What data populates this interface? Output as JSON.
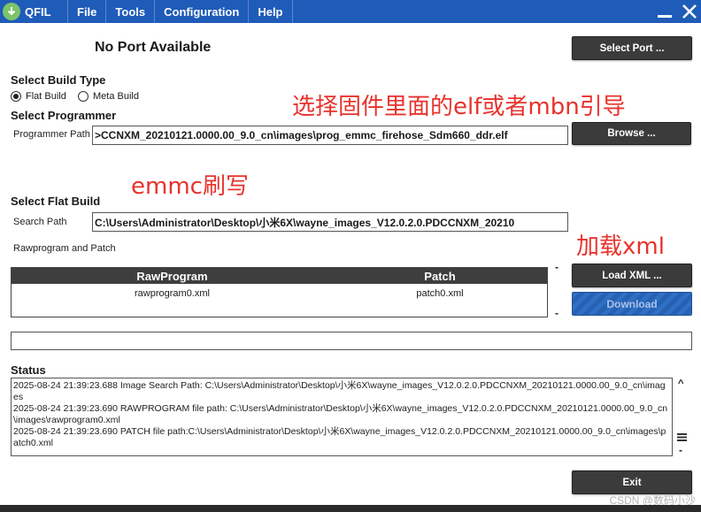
{
  "window": {
    "app_title": "QFIL",
    "menu": [
      "File",
      "Tools",
      "Configuration",
      "Help"
    ],
    "controls": [
      "minimize-icon",
      "close-icon"
    ]
  },
  "port": {
    "status_text": "No Port Available",
    "select_button": "Select Port ..."
  },
  "build_type": {
    "title": "Select Build Type",
    "options": [
      "Flat Build",
      "Meta Build"
    ],
    "selected": "Flat Build"
  },
  "programmer": {
    "title": "Select Programmer",
    "label": "Programmer Path",
    "path": ">CCNXM_20210121.0000.00_9.0_cn\\images\\prog_emmc_firehose_Sdm660_ddr.elf",
    "browse_button": "Browse ..."
  },
  "flat_build": {
    "title": "Select Flat Build",
    "search_label": "Search Path",
    "search_path": "C:\\Users\\Administrator\\Desktop\\小米6X\\wayne_images_V12.0.2.0.PDCCNXM_20210",
    "raw_patch_label": "Rawprogram and Patch",
    "table_headers": [
      "RawProgram",
      "Patch"
    ],
    "table_rows": [
      [
        "rawprogram0.xml",
        "patch0.xml"
      ]
    ],
    "dash_top": "-",
    "dash_bottom": "-",
    "load_xml_button": "Load XML ...",
    "download_button": "Download"
  },
  "annotations": {
    "elf_mbn": "选择固件里面的elf或者mbn引导",
    "emmc": "emmc刷写",
    "load_xml": "加载xml",
    "color": "#e8322c"
  },
  "progress": {
    "value": 0
  },
  "status": {
    "title": "Status",
    "lines": [
      "2025-08-24 21:39:23.688    Image Search Path: C:\\Users\\Administrator\\Desktop\\小米6X\\wayne_images_V12.0.2.0.PDCCNXM_20210121.0000.00_9.0_cn\\images",
      "2025-08-24 21:39:23.690    RAWPROGRAM file path: C:\\Users\\Administrator\\Desktop\\小米6X\\wayne_images_V12.0.2.0.PDCCNXM_20210121.0000.00_9.0_cn\\images\\rawprogram0.xml",
      "2025-08-24 21:39:23.690    PATCH file path:C:\\Users\\Administrator\\Desktop\\小米6X\\wayne_images_V12.0.2.0.PDCCNXM_20210121.0000.00_9.0_cn\\images\\patch0.xml"
    ],
    "scroll_up": "^",
    "scroll_dash": "-"
  },
  "exit_button": "Exit",
  "watermark": "CSDN @数码小沙",
  "colors": {
    "titlebar": "#1f5bb8",
    "button_dark": "#3b3b3b",
    "download": "#2f6fc4"
  }
}
